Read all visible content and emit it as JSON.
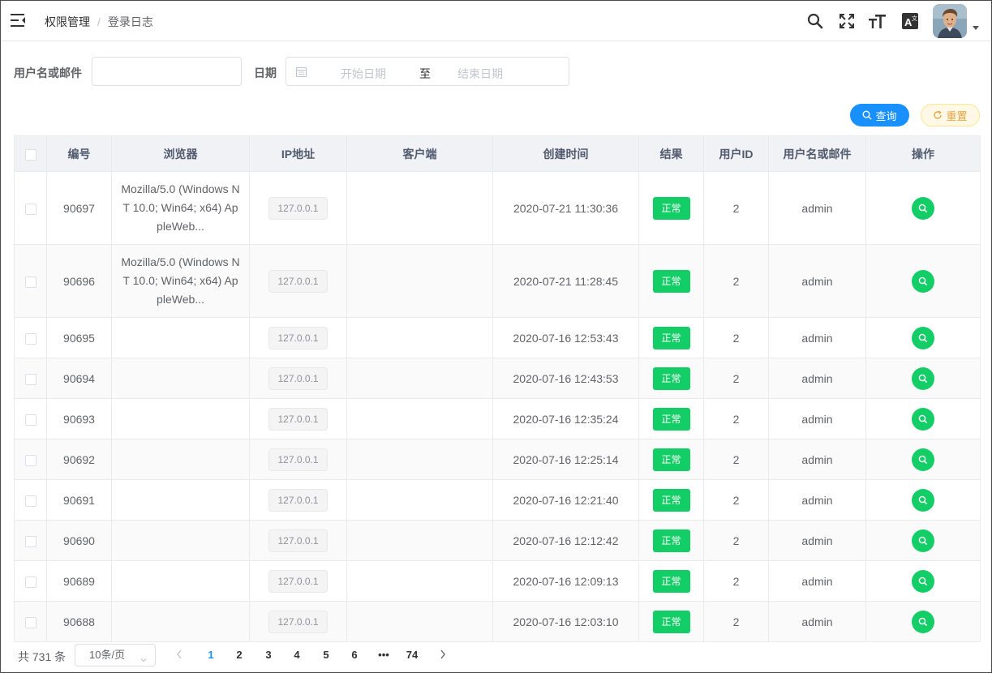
{
  "header": {
    "breadcrumb_root": "权限管理",
    "breadcrumb_sep": "/",
    "breadcrumb_current": "登录日志"
  },
  "filter": {
    "username_label": "用户名或邮件",
    "username_value": "",
    "date_label": "日期",
    "start_placeholder": "开始日期",
    "range_sep": "至",
    "end_placeholder": "结束日期",
    "search_label": "查询",
    "reset_label": "重置"
  },
  "table": {
    "columns": [
      "编号",
      "浏览器",
      "IP地址",
      "客户端",
      "创建时间",
      "结果",
      "用户ID",
      "用户名或邮件",
      "操作"
    ],
    "rows": [
      {
        "id": "90697",
        "browser": "Mozilla/5.0 (Windows NT 10.0; Win64; x64) AppleWeb...",
        "ip": "127.0.0.1",
        "client": "",
        "created": "2020-07-21 11:30:36",
        "result": "正常",
        "user_id": "2",
        "username": "admin"
      },
      {
        "id": "90696",
        "browser": "Mozilla/5.0 (Windows NT 10.0; Win64; x64) AppleWeb...",
        "ip": "127.0.0.1",
        "client": "",
        "created": "2020-07-21 11:28:45",
        "result": "正常",
        "user_id": "2",
        "username": "admin"
      },
      {
        "id": "90695",
        "browser": "",
        "ip": "127.0.0.1",
        "client": "",
        "created": "2020-07-16 12:53:43",
        "result": "正常",
        "user_id": "2",
        "username": "admin"
      },
      {
        "id": "90694",
        "browser": "",
        "ip": "127.0.0.1",
        "client": "",
        "created": "2020-07-16 12:43:53",
        "result": "正常",
        "user_id": "2",
        "username": "admin"
      },
      {
        "id": "90693",
        "browser": "",
        "ip": "127.0.0.1",
        "client": "",
        "created": "2020-07-16 12:35:24",
        "result": "正常",
        "user_id": "2",
        "username": "admin"
      },
      {
        "id": "90692",
        "browser": "",
        "ip": "127.0.0.1",
        "client": "",
        "created": "2020-07-16 12:25:14",
        "result": "正常",
        "user_id": "2",
        "username": "admin"
      },
      {
        "id": "90691",
        "browser": "",
        "ip": "127.0.0.1",
        "client": "",
        "created": "2020-07-16 12:21:40",
        "result": "正常",
        "user_id": "2",
        "username": "admin"
      },
      {
        "id": "90690",
        "browser": "",
        "ip": "127.0.0.1",
        "client": "",
        "created": "2020-07-16 12:12:42",
        "result": "正常",
        "user_id": "2",
        "username": "admin"
      },
      {
        "id": "90689",
        "browser": "",
        "ip": "127.0.0.1",
        "client": "",
        "created": "2020-07-16 12:09:13",
        "result": "正常",
        "user_id": "2",
        "username": "admin"
      },
      {
        "id": "90688",
        "browser": "",
        "ip": "127.0.0.1",
        "client": "",
        "created": "2020-07-16 12:03:10",
        "result": "正常",
        "user_id": "2",
        "username": "admin"
      }
    ]
  },
  "pagination": {
    "total": "共 731 条",
    "page_size": "10条/页",
    "pages": [
      "1",
      "2",
      "3",
      "4",
      "5",
      "6",
      "•••",
      "74"
    ],
    "current": "1"
  },
  "colors": {
    "primary": "#1890ff",
    "success": "#13ce66",
    "warning": "#e6a23c"
  },
  "icons": [
    "menu-fold-icon",
    "search-icon",
    "fullscreen-icon",
    "font-size-icon",
    "translate-icon",
    "calendar-icon",
    "refresh-icon",
    "view-icon"
  ]
}
